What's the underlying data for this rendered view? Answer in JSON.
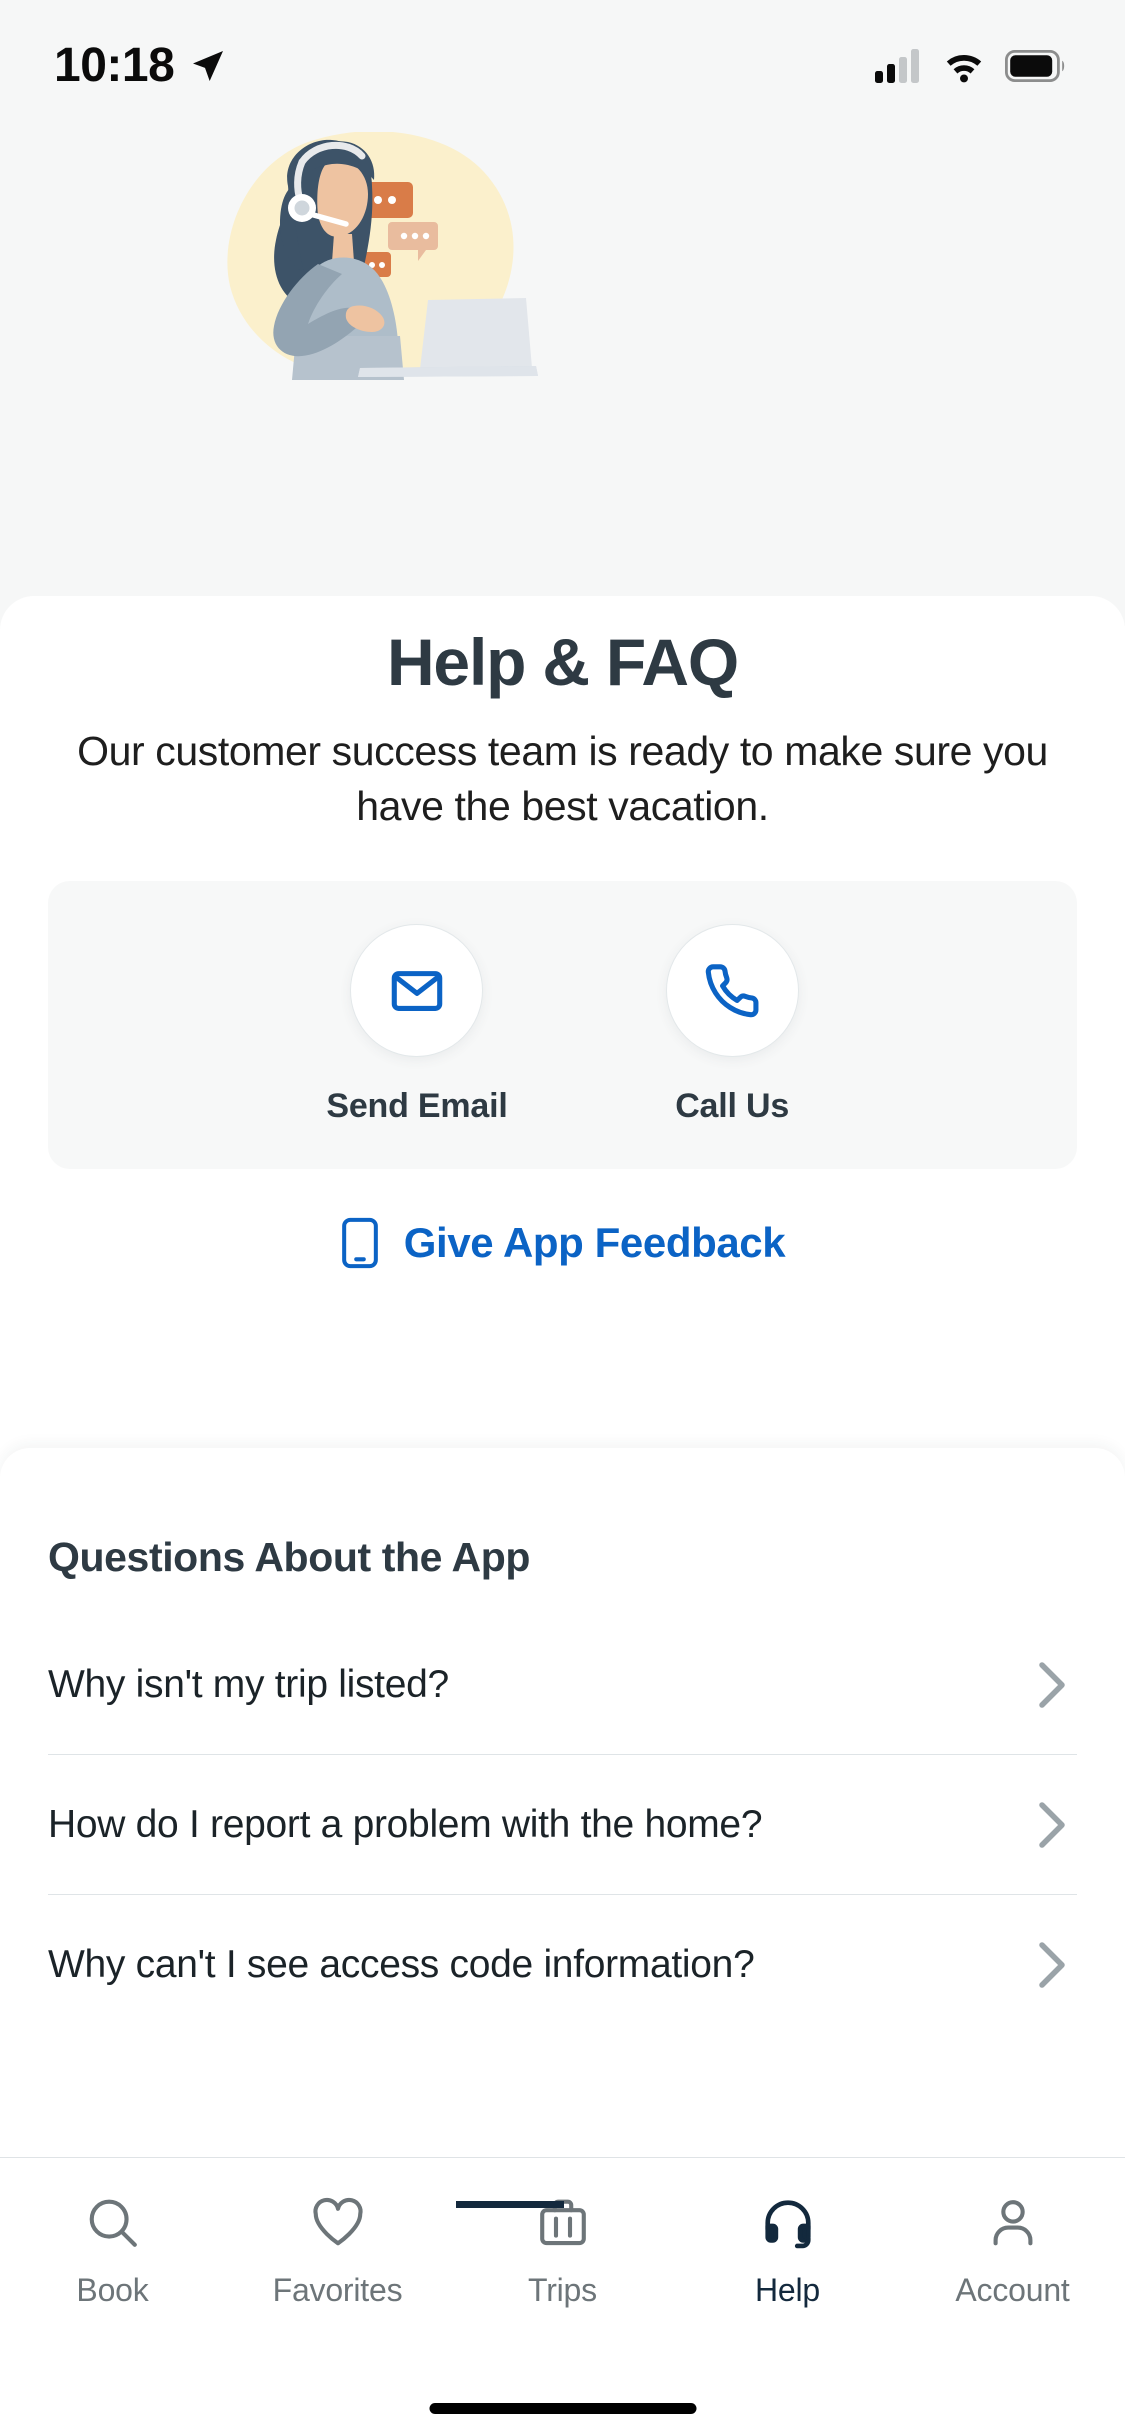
{
  "status_bar": {
    "time": "10:18",
    "location_icon": "location-arrow-icon",
    "signal_icon": "cellular-signal-icon",
    "wifi_icon": "wifi-icon",
    "battery_icon": "battery-icon"
  },
  "hero": {
    "illustration_name": "customer-support-agent-illustration",
    "colors": {
      "blob": "#fbf0cc",
      "hair": "#3d5368",
      "skin": "#eec3a1",
      "shirt": "#aebdc9",
      "arm": "#93a4b2",
      "laptop": "#e2e6eb",
      "bubble_dark": "#d97c48",
      "bubble_light": "#e9bc9e",
      "headset": "#e8eaec"
    }
  },
  "header": {
    "title": "Help & FAQ",
    "subtitle": "Our customer success team is ready to make sure you have the best vacation."
  },
  "contact": {
    "items": [
      {
        "label": "Send Email",
        "icon": "envelope-icon"
      },
      {
        "label": "Call Us",
        "icon": "phone-icon"
      }
    ],
    "feedback": {
      "label": "Give App Feedback",
      "icon": "mobile-phone-icon"
    }
  },
  "faq": {
    "section_title": "Questions About the App",
    "items": [
      {
        "question": "Why isn't my trip listed?",
        "chevron": "chevron-right-icon"
      },
      {
        "question": "How do I report a problem with the home?",
        "chevron": "chevron-right-icon"
      },
      {
        "question": "Why can't I see access code information?",
        "chevron": "chevron-right-icon"
      }
    ]
  },
  "tabbar": {
    "active": "Help",
    "items": [
      {
        "label": "Book",
        "icon": "search-icon"
      },
      {
        "label": "Favorites",
        "icon": "heart-icon"
      },
      {
        "label": "Trips",
        "icon": "suitcase-icon"
      },
      {
        "label": "Help",
        "icon": "headset-icon"
      },
      {
        "label": "Account",
        "icon": "person-icon"
      }
    ]
  },
  "colors": {
    "accent_blue": "#0b63c5",
    "text_dark": "#2e3a43",
    "active_tab": "#13293d",
    "inactive_tab": "#6d7579",
    "hero_bg": "#f6f7f7",
    "card_bg": "#f7f8f8"
  }
}
